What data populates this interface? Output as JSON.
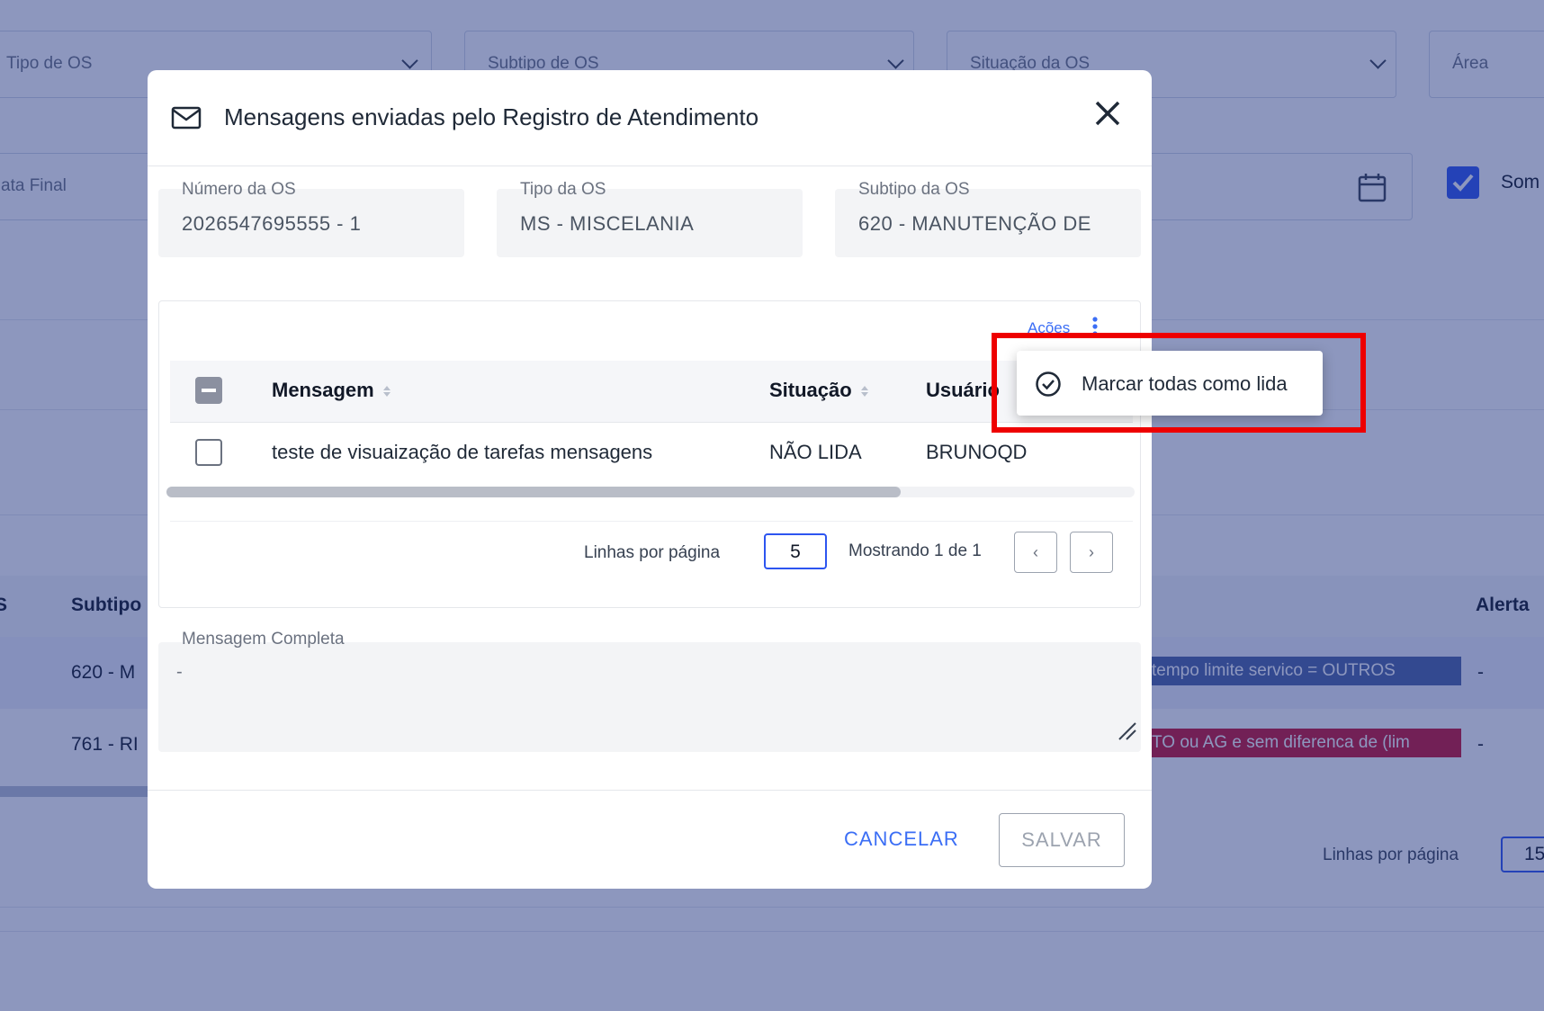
{
  "background": {
    "filters": {
      "tipo_os": "Tipo de OS",
      "subtipo_os": "Subtipo de OS",
      "situacao_os": "Situação da OS",
      "area": "Área",
      "data_final": "ata Final",
      "somente": "Som"
    },
    "table": {
      "col_os_partial": "S",
      "col_subtipo": "Subtipo",
      "col_alerta": "Alerta",
      "rows": [
        {
          "subtipo": "620 - M",
          "alert_text": "tempo limite servico = OUTROS",
          "alert_color": "#4b63a3",
          "alerta": "-"
        },
        {
          "subtipo": "761 - RI",
          "alert_text": "TO ou AG e sem diferenca de (lim",
          "alert_color": "#c8102e",
          "alerta": "-"
        }
      ]
    },
    "pagination": {
      "rows_label": "Linhas por página",
      "rows_value": "15"
    }
  },
  "modal": {
    "title": "Mensagens enviadas pelo Registro de Atendimento",
    "icon": "mail-icon",
    "fields": {
      "numero_label": "Número da OS",
      "numero_value": "2026547695555 - 1",
      "tipo_label": "Tipo da OS",
      "tipo_value": "MS - MISCELANIA",
      "subtipo_label": "Subtipo da OS",
      "subtipo_value": "620 -  MANUTENÇÃO DE"
    },
    "actions_label": "Acões",
    "table": {
      "columns": [
        "Mensagem",
        "Situação",
        "Usuário"
      ],
      "rows": [
        {
          "mensagem": "teste de visuaização de tarefas mensagens",
          "situacao": "NÃO LIDA",
          "usuario": "BRUNOQD"
        }
      ]
    },
    "pagination": {
      "rows_label": "Linhas por página",
      "rows_value": "5",
      "showing": "Mostrando 1 de 1"
    },
    "full_message_label": "Mensagem Completa",
    "full_message_value": "-",
    "cancel_label": "CANCELAR",
    "save_label": "SALVAR"
  },
  "dropdown_menu": {
    "item_label": "Marcar todas como lida",
    "item_icon": "check-circle-icon"
  },
  "colors": {
    "overlay": "#1b2f7d",
    "accent": "#3b6ef5",
    "checkbox_checked": "#2d55f0",
    "highlight": "#ee0000"
  }
}
